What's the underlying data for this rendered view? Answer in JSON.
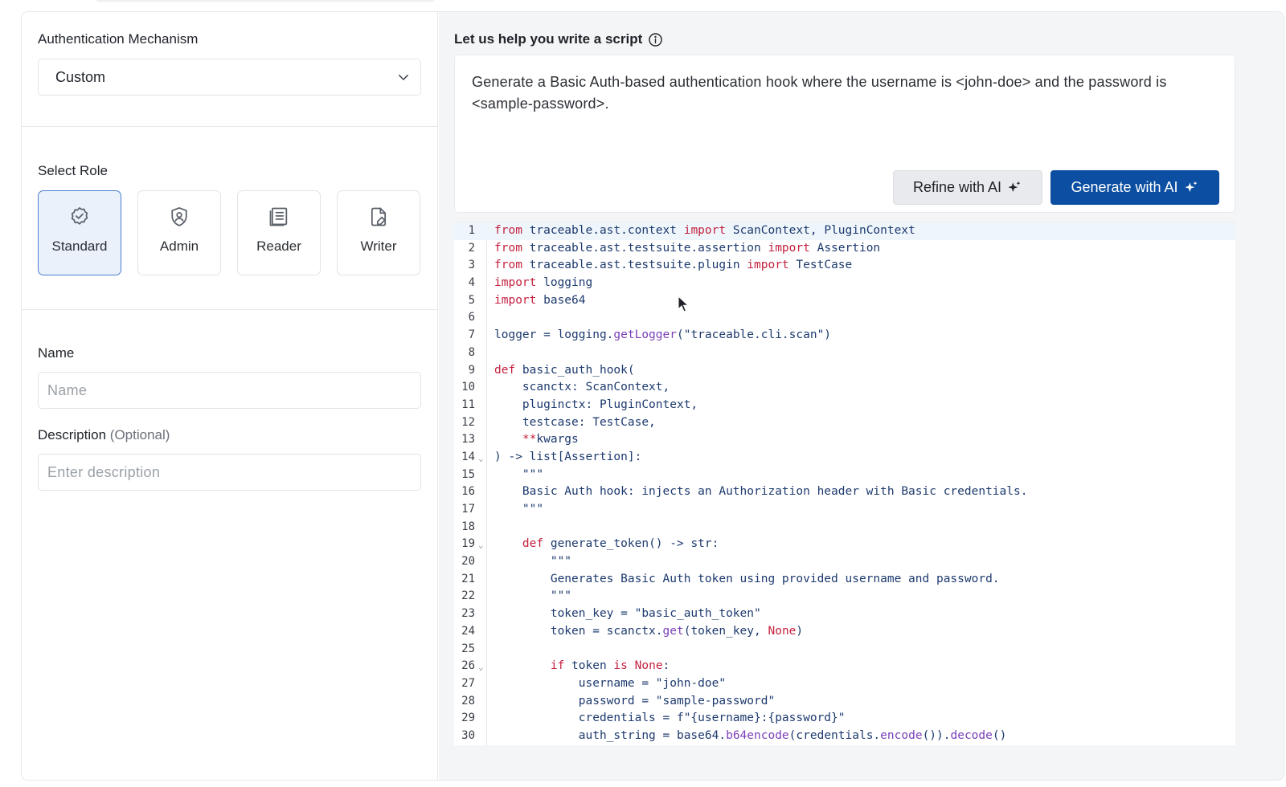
{
  "auth": {
    "title": "Authentication Mechanism",
    "selected": "Custom",
    "icon": "chevron-down-icon"
  },
  "roles": {
    "title": "Select Role",
    "items": [
      {
        "label": "Standard",
        "icon": "badge-check-icon",
        "selected": true
      },
      {
        "label": "Admin",
        "icon": "shield-user-icon",
        "selected": false
      },
      {
        "label": "Reader",
        "icon": "document-lines-icon",
        "selected": false
      },
      {
        "label": "Writer",
        "icon": "document-edit-icon",
        "selected": false
      }
    ]
  },
  "name": {
    "label": "Name",
    "placeholder": "Name",
    "value": ""
  },
  "description": {
    "label": "Description",
    "optional": "(Optional)",
    "placeholder": "Enter description",
    "value": ""
  },
  "assistant": {
    "title": "Let us help you write a script",
    "info_icon": "info-icon",
    "prompt": "Generate a Basic Auth-based authentication hook where the username is <john-doe> and the password is <sample-password>.",
    "refine_label": "Refine with AI",
    "generate_label": "Generate with AI",
    "sparkle_icon": "sparkle-icon"
  },
  "colors": {
    "primary": "#0b4ea2",
    "selected_role_bg": "#eaf1fb",
    "selected_role_border": "#4a7fd0",
    "keyword": "#c4223f",
    "function": "#7a3fb8",
    "code_text": "#1d3a6e"
  },
  "editor": {
    "active_line": 1,
    "fold_lines": [
      14,
      19,
      26
    ],
    "lines": [
      [
        [
          "kw",
          "from"
        ],
        [
          "p",
          " traceable.ast.context "
        ],
        [
          "kw",
          "import"
        ],
        [
          "p",
          " ScanContext, PluginContext"
        ]
      ],
      [
        [
          "kw",
          "from"
        ],
        [
          "p",
          " traceable.ast.testsuite.assertion "
        ],
        [
          "kw",
          "import"
        ],
        [
          "p",
          " Assertion"
        ]
      ],
      [
        [
          "kw",
          "from"
        ],
        [
          "p",
          " traceable.ast.testsuite.plugin "
        ],
        [
          "kw",
          "import"
        ],
        [
          "p",
          " TestCase"
        ]
      ],
      [
        [
          "kw",
          "import"
        ],
        [
          "p",
          " logging"
        ]
      ],
      [
        [
          "kw",
          "import"
        ],
        [
          "p",
          " base64"
        ]
      ],
      [],
      [
        [
          "p",
          "logger = logging."
        ],
        [
          "fn",
          "getLogger"
        ],
        [
          "p",
          "(\"traceable.cli.scan\")"
        ]
      ],
      [],
      [
        [
          "kw",
          "def"
        ],
        [
          "p",
          " basic_auth_hook("
        ]
      ],
      [
        [
          "p",
          "    scanctx: ScanContext,"
        ]
      ],
      [
        [
          "p",
          "    pluginctx: PluginContext,"
        ]
      ],
      [
        [
          "p",
          "    testcase: TestCase,"
        ]
      ],
      [
        [
          "p",
          "    "
        ],
        [
          "kw",
          "**"
        ],
        [
          "p",
          "kwargs"
        ]
      ],
      [
        [
          "p",
          ") -> list[Assertion]:"
        ]
      ],
      [
        [
          "p",
          "    \"\"\""
        ]
      ],
      [
        [
          "p",
          "    Basic Auth hook: injects an Authorization header with Basic credentials."
        ]
      ],
      [
        [
          "p",
          "    \"\"\""
        ]
      ],
      [],
      [
        [
          "p",
          "    "
        ],
        [
          "kw",
          "def"
        ],
        [
          "p",
          " generate_token() -> str:"
        ]
      ],
      [
        [
          "p",
          "        \"\"\""
        ]
      ],
      [
        [
          "p",
          "        Generates Basic Auth token using provided username and password."
        ]
      ],
      [
        [
          "p",
          "        \"\"\""
        ]
      ],
      [
        [
          "p",
          "        token_key = \"basic_auth_token\""
        ]
      ],
      [
        [
          "p",
          "        token = scanctx."
        ],
        [
          "fn",
          "get"
        ],
        [
          "p",
          "(token_key, "
        ],
        [
          "kw",
          "None"
        ],
        [
          "p",
          ")"
        ]
      ],
      [],
      [
        [
          "p",
          "        "
        ],
        [
          "kw",
          "if"
        ],
        [
          "p",
          " token "
        ],
        [
          "kw",
          "is"
        ],
        [
          "p",
          " "
        ],
        [
          "kw",
          "None"
        ],
        [
          "p",
          ":"
        ]
      ],
      [
        [
          "p",
          "            username = \"john-doe\""
        ]
      ],
      [
        [
          "p",
          "            password = \"sample-password\""
        ]
      ],
      [
        [
          "p",
          "            credentials = f\"{username}:{password}\""
        ]
      ],
      [
        [
          "p",
          "            auth_string = base64."
        ],
        [
          "fn",
          "b64encode"
        ],
        [
          "p",
          "(credentials."
        ],
        [
          "fn",
          "encode"
        ],
        [
          "p",
          "())."
        ],
        [
          "fn",
          "decode"
        ],
        [
          "p",
          "()"
        ]
      ]
    ]
  }
}
